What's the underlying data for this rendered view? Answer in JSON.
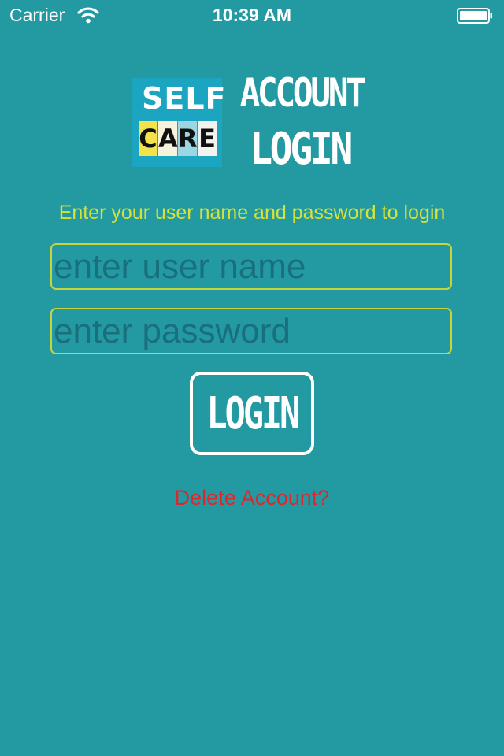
{
  "status_bar": {
    "carrier": "Carrier",
    "time": "10:39 AM",
    "icons": [
      "wifi-icon",
      "battery-icon"
    ]
  },
  "logo": {
    "self": "SELF",
    "care_letters": [
      "C",
      "A",
      "R",
      "E"
    ]
  },
  "title": {
    "line1": "ACCOUNT",
    "line2": "LOGIN"
  },
  "instructions": "Enter your user name and password to login",
  "form": {
    "username_placeholder": "enter user name",
    "username_value": "",
    "password_placeholder": "enter password",
    "password_value": "",
    "login_label": "LOGIN"
  },
  "delete_account_label": "Delete Account?",
  "colors": {
    "background": "#2399a1",
    "instruction_text": "#d6e13a",
    "field_border": "#c7d43b",
    "delete_link": "#d9292f",
    "white": "#ffffff"
  }
}
